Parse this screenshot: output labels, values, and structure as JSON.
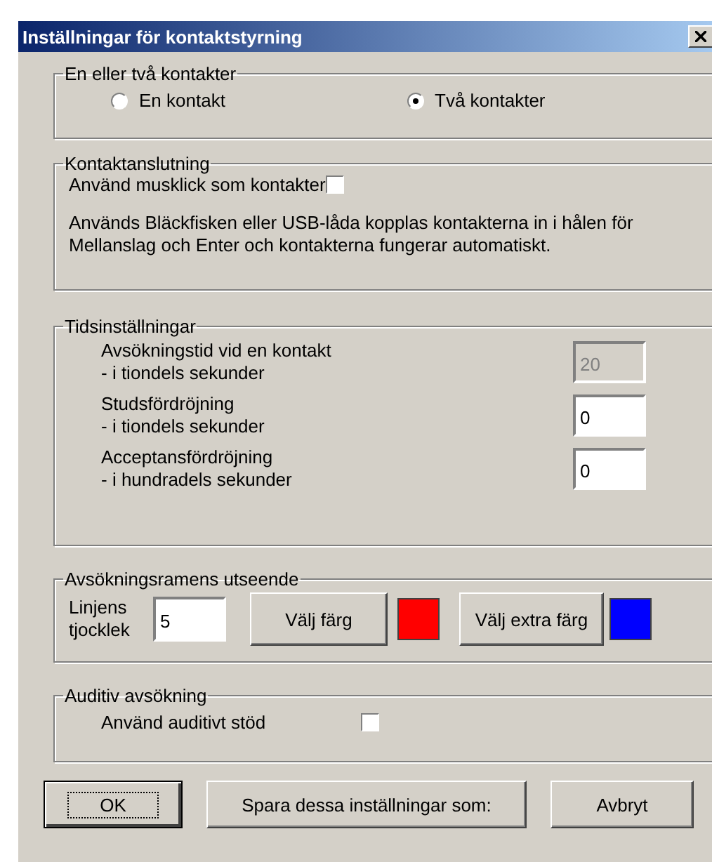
{
  "window": {
    "title": "Inställningar för kontaktstyrning"
  },
  "switch_count": {
    "legend": "En eller två kontakter",
    "options": [
      {
        "label": "En kontakt",
        "selected": false
      },
      {
        "label": "Två kontakter",
        "selected": true
      }
    ]
  },
  "connection": {
    "legend": "Kontaktanslutning",
    "mouse_click": {
      "label": "Använd musklick som kontakter",
      "checked": false
    },
    "note": "Används Bläckfisken eller USB-låda kopplas kontakterna in i hålen för Mellanslag och Enter och kontakterna fungerar automatiskt."
  },
  "timing": {
    "legend": "Tidsinställningar",
    "fields": [
      {
        "label": "Avsökningstid vid en kontakt",
        "sublabel": "- i tiondels sekunder",
        "value": "20",
        "disabled": true
      },
      {
        "label": "Studsfördröjning",
        "sublabel": "- i tiondels sekunder",
        "value": "0",
        "disabled": false
      },
      {
        "label": "Acceptansfördröjning",
        "sublabel": "- i hundradels sekunder",
        "value": "0",
        "disabled": false
      }
    ]
  },
  "frame": {
    "legend": "Avsökningsramens utseende",
    "thickness_label": "Linjens tjocklek",
    "thickness": "5",
    "colors": [
      {
        "label": "Välj färg",
        "color": "#ff0000"
      },
      {
        "label": "Välj extra färg",
        "color": "#0000ff"
      }
    ]
  },
  "auditory": {
    "legend": "Auditiv avsökning",
    "checkbox": {
      "label": "Använd auditivt stöd",
      "checked": false
    }
  },
  "buttons": [
    {
      "label": "OK",
      "default": true
    },
    {
      "label": "Spara dessa inställningar som:",
      "default": false
    },
    {
      "label": "Avbryt",
      "default": false
    }
  ]
}
